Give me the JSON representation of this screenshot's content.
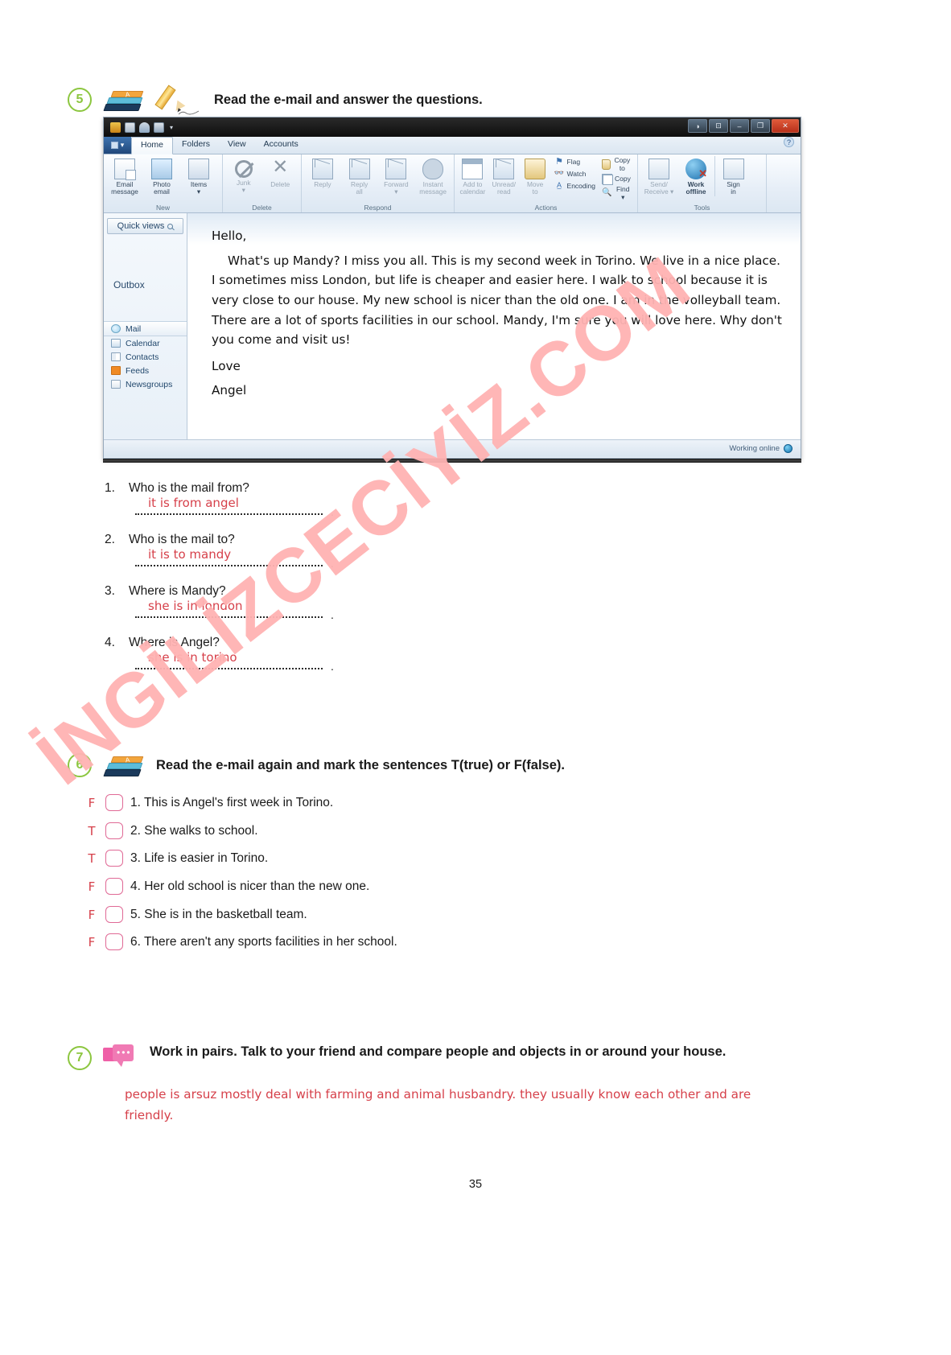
{
  "page": {
    "number": "35"
  },
  "watermark": {
    "text": "İNGİLİZCECİYİZ.COM",
    "color": "#ffb3b3"
  },
  "exercise5": {
    "number": "5",
    "title": "Read the e-mail and answer the questions.",
    "icons": [
      "books-icon",
      "pencil-icon"
    ],
    "questions": [
      {
        "num": "1.",
        "text": "Who is the mail from?",
        "answer": "it is from angel"
      },
      {
        "num": "2.",
        "text": "Who is the mail to?",
        "answer": "it is to mandy"
      },
      {
        "num": "3.",
        "text": "Where is Mandy?",
        "answer": "she is in london"
      },
      {
        "num": "4.",
        "text": "Where is Angel?",
        "answer": "she is in torino"
      }
    ]
  },
  "mail_client": {
    "titlebar": {
      "quick_access_icons": [
        "app-icon",
        "new-mail-icon",
        "send-receive-icon",
        "print-icon"
      ],
      "dropdown": "▾",
      "window_buttons": [
        "◑",
        "⊡",
        "–",
        "❐",
        "✕"
      ]
    },
    "ribbon": {
      "file_menu": "▾",
      "tabs": [
        "Home",
        "Folders",
        "View",
        "Accounts"
      ],
      "active_tab": "Home",
      "help": "?",
      "groups": [
        {
          "label": "New",
          "buttons": [
            {
              "line1": "Email",
              "line2": "message",
              "icon": "email-message-icon",
              "dim": false
            },
            {
              "line1": "Photo",
              "line2": "email",
              "icon": "photo-email-icon",
              "dim": false
            },
            {
              "line1": "Items",
              "line2": "▾",
              "icon": "items-icon",
              "dim": false
            }
          ]
        },
        {
          "label": "Delete",
          "buttons": [
            {
              "line1": "Junk",
              "line2": "▾",
              "icon": "junk-icon",
              "dim": true
            },
            {
              "line1": "Delete",
              "line2": "",
              "icon": "delete-icon",
              "dim": true
            }
          ]
        },
        {
          "label": "Respond",
          "buttons": [
            {
              "line1": "Reply",
              "line2": "",
              "icon": "reply-icon",
              "dim": true
            },
            {
              "line1": "Reply",
              "line2": "all",
              "icon": "reply-all-icon",
              "dim": true
            },
            {
              "line1": "Forward",
              "line2": "▾",
              "icon": "forward-icon",
              "dim": true
            },
            {
              "line1": "Instant",
              "line2": "message",
              "icon": "instant-message-icon",
              "dim": true
            }
          ]
        },
        {
          "label": "Actions",
          "buttons": [
            {
              "line1": "Add to",
              "line2": "calendar",
              "icon": "add-to-calendar-icon",
              "dim": true
            },
            {
              "line1": "Unread/",
              "line2": "read",
              "icon": "unread-read-icon",
              "dim": true
            },
            {
              "line1": "Move",
              "line2": "to",
              "icon": "move-to-icon",
              "dim": true
            }
          ],
          "small_buttons_col1": [
            {
              "label": "Flag",
              "icon": "flag-icon"
            },
            {
              "label": "Watch",
              "icon": "watch-icon"
            },
            {
              "label": "Encoding",
              "icon": "encoding-icon"
            }
          ],
          "small_buttons_col2": [
            {
              "label": "Copy to",
              "icon": "copy-to-icon"
            },
            {
              "label": "Copy",
              "icon": "copy-icon"
            },
            {
              "label": "Find ▾",
              "icon": "find-icon"
            }
          ]
        },
        {
          "label": "Tools",
          "buttons": [
            {
              "line1": "Send/",
              "line2": "Receive ▾",
              "icon": "send-receive-icon",
              "dim": true
            },
            {
              "line1": "Work",
              "line2": "offline",
              "icon": "work-offline-icon",
              "dim": false
            },
            {
              "line1": "Sign",
              "line2": "in",
              "icon": "sign-in-icon",
              "dim": false
            }
          ]
        }
      ]
    },
    "sidebar": {
      "quick_views": "Quick views",
      "outbox": "Outbox",
      "folders": [
        {
          "label": "Mail",
          "icon": "mail-icon",
          "selected": true
        },
        {
          "label": "Calendar",
          "icon": "calendar-icon",
          "selected": false
        },
        {
          "label": "Contacts",
          "icon": "contacts-icon",
          "selected": false
        },
        {
          "label": "Feeds",
          "icon": "feeds-icon",
          "selected": false
        },
        {
          "label": "Newsgroups",
          "icon": "newsgroups-icon",
          "selected": false
        }
      ]
    },
    "message": {
      "greeting": "Hello,",
      "body": "What's up Mandy? I miss you all. This is my second week in Torino. We live in a nice place. I sometimes miss London, but life is cheaper and easier here. I walk to school because it is very close to our house. My new school is nicer than the old one. I am in the volleyball team. There are a lot of sports facilities in our school. Mandy, I'm sure you will love here. Why don't you come and visit us!",
      "closing": "Love",
      "signature": "Angel"
    },
    "status": {
      "text": "Working online"
    }
  },
  "exercise6": {
    "number": "6",
    "title": "Read the e-mail again and mark the sentences T(true) or F(false).",
    "icons": [
      "books-icon"
    ],
    "items": [
      {
        "mark": "F",
        "text": "1. This is Angel's first week in Torino."
      },
      {
        "mark": "T",
        "text": "2. She walks to school."
      },
      {
        "mark": "T",
        "text": "3. Life is easier in Torino."
      },
      {
        "mark": "F",
        "text": "4. Her old school is nicer than the new one."
      },
      {
        "mark": "F",
        "text": "5. She is in the basketball team."
      },
      {
        "mark": "F",
        "text": "6. There aren't any sports facilities in her school."
      }
    ]
  },
  "exercise7": {
    "number": "7",
    "title": "Work in pairs. Talk to  your friend and compare people and objects in or around your house.",
    "icons": [
      "speech-bubble-icon"
    ],
    "answer": "people is arsuz mostly deal with farming and animal husbandry. they usually know each other and are friendly."
  }
}
